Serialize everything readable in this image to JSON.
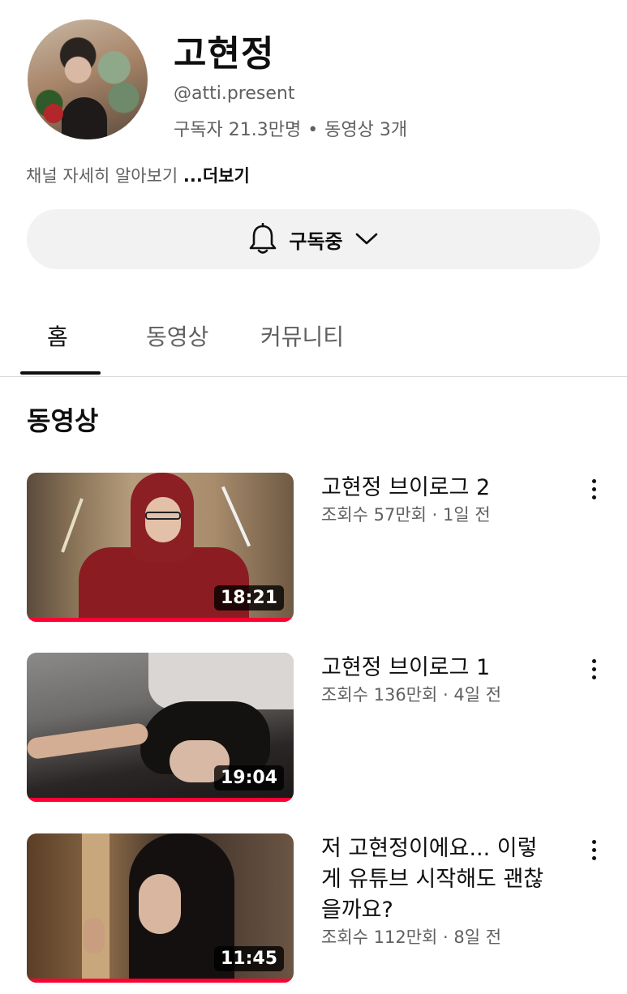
{
  "channel": {
    "name": "고현정",
    "handle": "@atti.present",
    "subscribers": "구독자 21.3만명",
    "separator": "•",
    "video_count": "동영상 3개",
    "about_text": "채널 자세히 알아보기",
    "more_label": "...더보기"
  },
  "subscribe": {
    "label": "구독중",
    "bell_icon": "bell-icon",
    "dropdown_icon": "chevron-down-icon"
  },
  "tabs": [
    {
      "label": "홈",
      "active": true
    },
    {
      "label": "동영상",
      "active": false
    },
    {
      "label": "커뮤니티",
      "active": false
    }
  ],
  "section_title": "동영상",
  "videos": [
    {
      "title": "고현정 브이로그 2",
      "meta": "조회수 57만회 · 1일 전",
      "duration": "18:21",
      "watched_progress": 1.0
    },
    {
      "title": "고현정 브이로그 1",
      "meta": "조회수 136만회 · 4일 전",
      "duration": "19:04",
      "watched_progress": 1.0
    },
    {
      "title": "저 고현정이에요... 이렇게 유튜브 시작해도 괜찮을까요?",
      "meta": "조회수 112만회 · 8일 전",
      "duration": "11:45",
      "watched_progress": 1.0
    }
  ],
  "colors": {
    "accent": "#ff0033",
    "text_primary": "#0f0f0f",
    "text_secondary": "#606060",
    "button_bg": "#f2f2f2"
  }
}
